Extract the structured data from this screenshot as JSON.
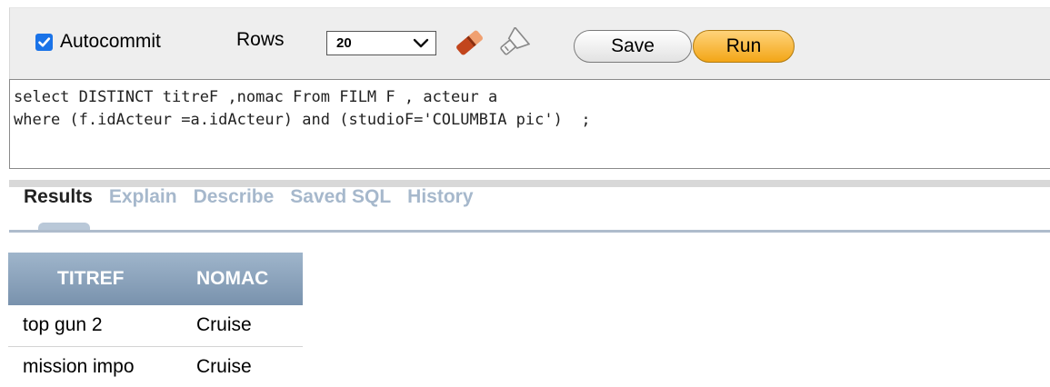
{
  "toolbar": {
    "autocommit_label": "Autocommit",
    "autocommit_checked": true,
    "rows_label": "Rows",
    "rows_value": "20",
    "save_label": "Save",
    "run_label": "Run",
    "icons": [
      "eraser-icon",
      "flashlight-icon",
      "chevron-down-icon",
      "checkmark-icon"
    ],
    "colors": {
      "checkbox": "#1a73e8",
      "run_button": "#f3a617"
    }
  },
  "editor": {
    "lines": [
      "select DISTINCT titreF ,nomac From FILM F , acteur a",
      "where (f.idActeur =a.idActeur) and (studioF='COLUMBIA pic')  ;"
    ]
  },
  "tabs": [
    {
      "label": "Results",
      "active": true
    },
    {
      "label": "Explain",
      "active": false
    },
    {
      "label": "Describe",
      "active": false
    },
    {
      "label": "Saved SQL",
      "active": false
    },
    {
      "label": "History",
      "active": false
    }
  ],
  "results": {
    "columns": [
      "TITREF",
      "NOMAC"
    ],
    "rows": [
      [
        "top gun 2",
        "Cruise"
      ],
      [
        "mission impo",
        "Cruise"
      ]
    ]
  }
}
